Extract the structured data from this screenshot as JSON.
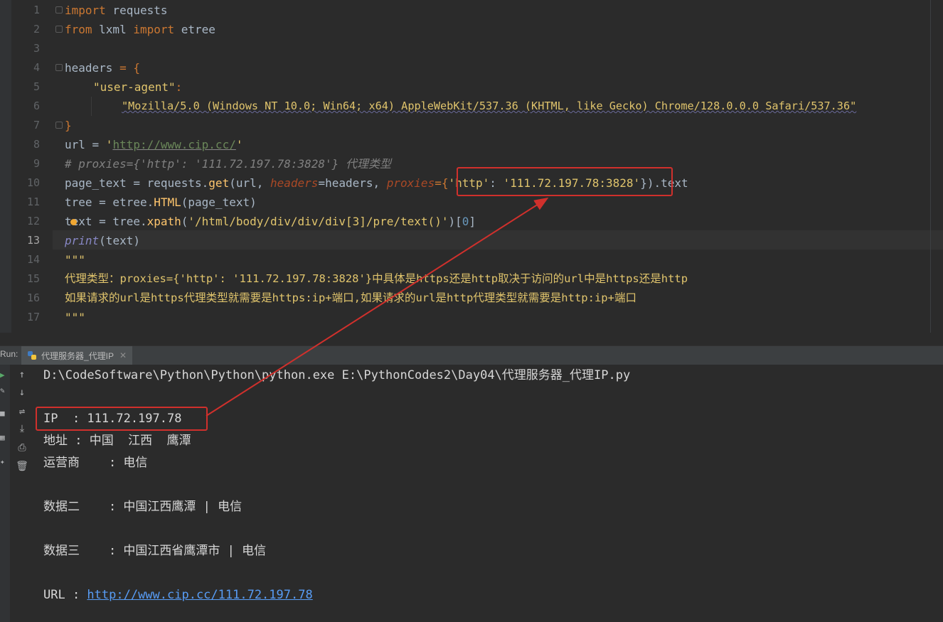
{
  "editor": {
    "line_numbers": [
      "1",
      "2",
      "3",
      "4",
      "5",
      "6",
      "7",
      "8",
      "9",
      "10",
      "11",
      "12",
      "13",
      "14",
      "15",
      "16",
      "17"
    ],
    "current_line": "13",
    "code": {
      "l1_kw": "import",
      "l1_rest": " requests",
      "l2_kw1": "from",
      "l2_mid": " lxml ",
      "l2_kw2": "import",
      "l2_rest": " etree",
      "l4_a": "headers ",
      "l4_op": "= {",
      "l5_str": "\"user-agent\"",
      "l5_op": ":",
      "l6_str": "\"Mozilla/5.0 (Windows NT 10.0; Win64; x64) AppleWebKit/537.36 (KHTML, like Gecko) Chrome/128.0.0.0 Safari/537.36\"",
      "l7": "}",
      "l8_a": "url = ",
      "l8_q1": "'",
      "l8_url": "http://www.cip.cc/",
      "l8_q2": "'",
      "l9_cmt": "# proxies={'http': '111.72.197.78:3828'} 代理类型",
      "l10_a": "page_text = requests.",
      "l10_fn": "get",
      "l10_b": "(url, ",
      "l10_p1": "headers",
      "l10_c": "=headers, ",
      "l10_p2": "proxies",
      "l10_d": "={",
      "l10_s1": "'http'",
      "l10_e": ": ",
      "l10_s2": "'111.72.197.78:3828'",
      "l10_f": "}).text",
      "l11_a": "tree = etree.",
      "l11_fn": "HTML",
      "l11_b": "(page_text)",
      "l12_a": "text = tree.",
      "l12_fn": "xpath",
      "l12_b": "(",
      "l12_s": "'/html/body/div/div/div[3]/pre/text()'",
      "l12_c": ")[",
      "l12_n": "0",
      "l12_d": "]",
      "l13_fn": "print",
      "l13_b": "(text)",
      "l14": "\"\"\"",
      "l15": "代理类型：proxies={'http': '111.72.197.78:3828'}中具体是https还是http取决于访问的url中是https还是http",
      "l16": "如果请求的url是https代理类型就需要是https:ip+端口,如果请求的url是http代理类型就需要是http:ip+端口",
      "l17": "\"\"\""
    }
  },
  "run_panel": {
    "label": "Run:",
    "tab_title": "代理服务器_代理IP",
    "output": {
      "cmd": "D:\\CodeSoftware\\Python\\Python\\python.exe E:\\PythonCodes2\\Day04\\代理服务器_代理IP.py",
      "ip": "IP  : 111.72.197.78",
      "addr": "地址 : 中国  江西  鹰潭",
      "isp": "运营商    : 电信",
      "data2": "数据二    : 中国江西鹰潭 | 电信",
      "data3": "数据三    : 中国江西省鹰潭市 | 电信",
      "url_label": "URL : ",
      "url_link": "http://www.cip.cc/111.72.197.78"
    }
  },
  "colors": {
    "annotation_red": "#d0302c",
    "background": "#2b2b2b"
  }
}
